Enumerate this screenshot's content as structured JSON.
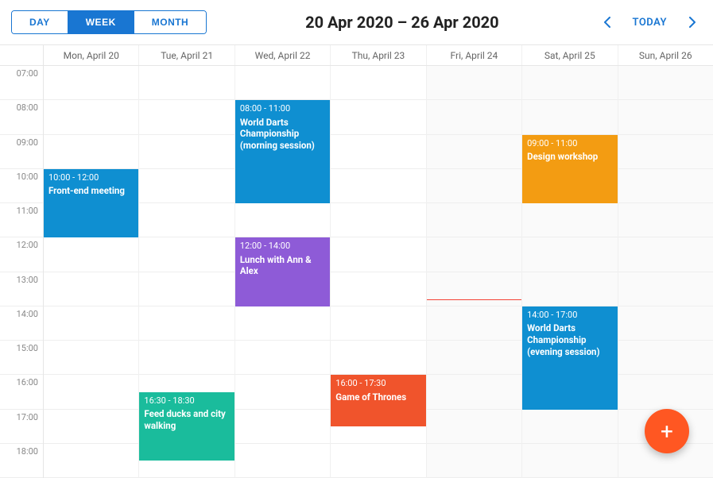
{
  "toolbar": {
    "views": {
      "day": "DAY",
      "week": "WEEK",
      "month": "MONTH",
      "active": "week"
    },
    "title": "20 Apr 2020 – 26 Apr 2020",
    "today": "TODAY"
  },
  "days": [
    {
      "label": "Mon, April 20",
      "shade": false
    },
    {
      "label": "Tue, April 21",
      "shade": false
    },
    {
      "label": "Wed, April 22",
      "shade": false
    },
    {
      "label": "Thu, April 23",
      "shade": false
    },
    {
      "label": "Fri, April 24",
      "shade": true,
      "nowHour": 13.8
    },
    {
      "label": "Sat, April 25",
      "shade": true
    },
    {
      "label": "Sun, April 26",
      "shade": true
    }
  ],
  "startHour": 7,
  "endHour": 18,
  "hourLabels": [
    "07:00",
    "08:00",
    "09:00",
    "10:00",
    "11:00",
    "12:00",
    "13:00",
    "14:00",
    "15:00",
    "16:00",
    "17:00",
    "18:00"
  ],
  "events": [
    {
      "day": 0,
      "start": 10,
      "end": 12,
      "time": "10:00 - 12:00",
      "title": "Front-end meeting",
      "color": "#0f8fd1"
    },
    {
      "day": 1,
      "start": 16.5,
      "end": 18.5,
      "time": "16:30 - 18:30",
      "title": "Feed ducks and city walking",
      "color": "#1abc9c"
    },
    {
      "day": 2,
      "start": 8,
      "end": 11,
      "time": "08:00 - 11:00",
      "title": "World Darts Championship (morning session)",
      "color": "#0f8fd1"
    },
    {
      "day": 2,
      "start": 12,
      "end": 14,
      "time": "12:00 - 14:00",
      "title": "Lunch with Ann & Alex",
      "color": "#8e5bd7"
    },
    {
      "day": 3,
      "start": 16,
      "end": 17.5,
      "time": "16:00 - 17:30",
      "title": "Game of Thrones",
      "color": "#f0542c"
    },
    {
      "day": 5,
      "start": 9,
      "end": 11,
      "time": "09:00 - 11:00",
      "title": "Design workshop",
      "color": "#f39c12"
    },
    {
      "day": 5,
      "start": 14,
      "end": 17,
      "time": "14:00 - 17:00",
      "title": "World Darts Championship (evening session)",
      "color": "#0f8fd1"
    }
  ],
  "fab": {
    "label": "+"
  }
}
